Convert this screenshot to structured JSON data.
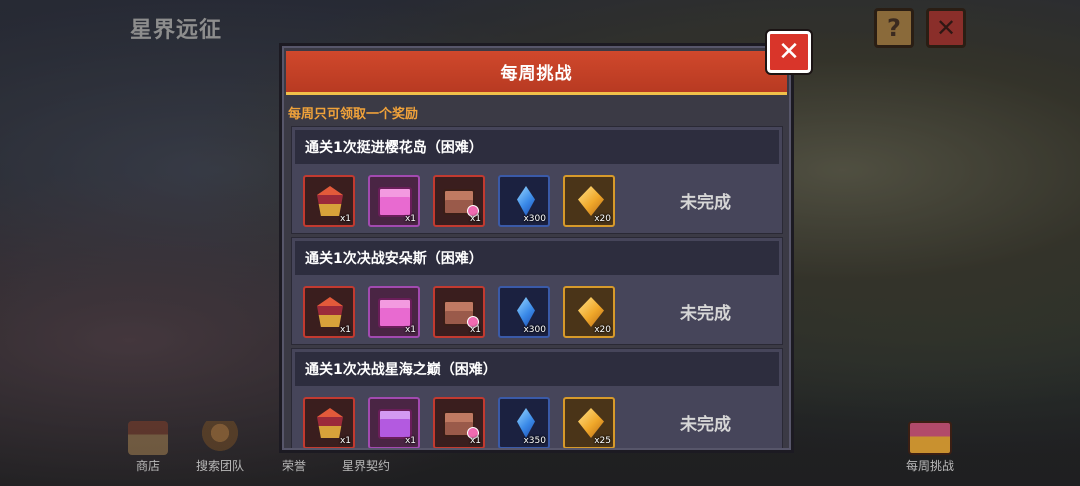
{
  "game": {
    "title": "星界远征"
  },
  "top_buttons": {
    "help": "?",
    "close": "✕"
  },
  "bottom_nav": [
    {
      "label": "商店"
    },
    {
      "label": "搜索团队"
    },
    {
      "label": "荣誉"
    },
    {
      "label": "星界契约"
    },
    {
      "label": "每周挑战"
    }
  ],
  "modal": {
    "title": "每周挑战",
    "close": "✕",
    "notice": "每周只可领取一个奖励",
    "challenges": [
      {
        "title": "通关1次挺进樱花岛（困难）",
        "status": "未完成",
        "rewards": [
          {
            "icon": "relic-icon",
            "qty": "x1"
          },
          {
            "icon": "pink-box-icon",
            "qty": "x1"
          },
          {
            "icon": "treasure-chest-icon",
            "qty": "x1"
          },
          {
            "icon": "blue-crystal-icon",
            "qty": "x300"
          },
          {
            "icon": "gold-crystal-icon",
            "qty": "x20"
          }
        ]
      },
      {
        "title": "通关1次决战安朵斯（困难）",
        "status": "未完成",
        "rewards": [
          {
            "icon": "relic-icon",
            "qty": "x1"
          },
          {
            "icon": "pink-box-icon",
            "qty": "x1"
          },
          {
            "icon": "treasure-chest-icon",
            "qty": "x1"
          },
          {
            "icon": "blue-crystal-icon",
            "qty": "x300"
          },
          {
            "icon": "gold-crystal-icon",
            "qty": "x20"
          }
        ]
      },
      {
        "title": "通关1次决战星海之巅（困难）",
        "status": "未完成",
        "rewards": [
          {
            "icon": "relic-icon",
            "qty": "x1"
          },
          {
            "icon": "purple-box-icon",
            "qty": "x1"
          },
          {
            "icon": "treasure-chest-icon",
            "qty": "x1"
          },
          {
            "icon": "blue-crystal-icon",
            "qty": "x350"
          },
          {
            "icon": "gold-crystal-icon",
            "qty": "x25"
          }
        ]
      }
    ]
  },
  "colors": {
    "header_red": "#c8412a",
    "header_border_gold": "#f0c04a",
    "notice_orange": "#f0a23a",
    "panel_bg": "#3b3a45"
  }
}
